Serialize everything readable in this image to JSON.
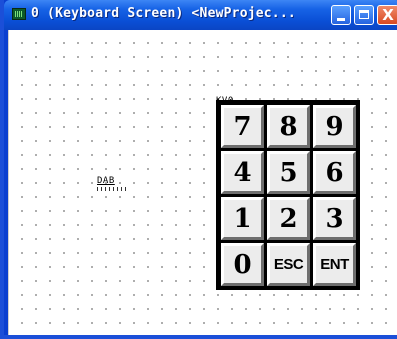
{
  "window": {
    "title": "0 (Keyboard Screen) <NewProjec...",
    "minimize_label": "",
    "maximize_label": "",
    "close_label": "X"
  },
  "canvas": {
    "dab_object_label": "DAB",
    "keypad_object_label": "KV0"
  },
  "keypad": {
    "keys": [
      "7",
      "8",
      "9",
      "4",
      "5",
      "6",
      "1",
      "2",
      "3",
      "0",
      "ESC",
      "ENT"
    ]
  },
  "colors": {
    "titlebar": "#0a4fd6",
    "key_face": "#ececec",
    "grid_dot": "#9a9a9a",
    "close_button": "#d84a22"
  }
}
